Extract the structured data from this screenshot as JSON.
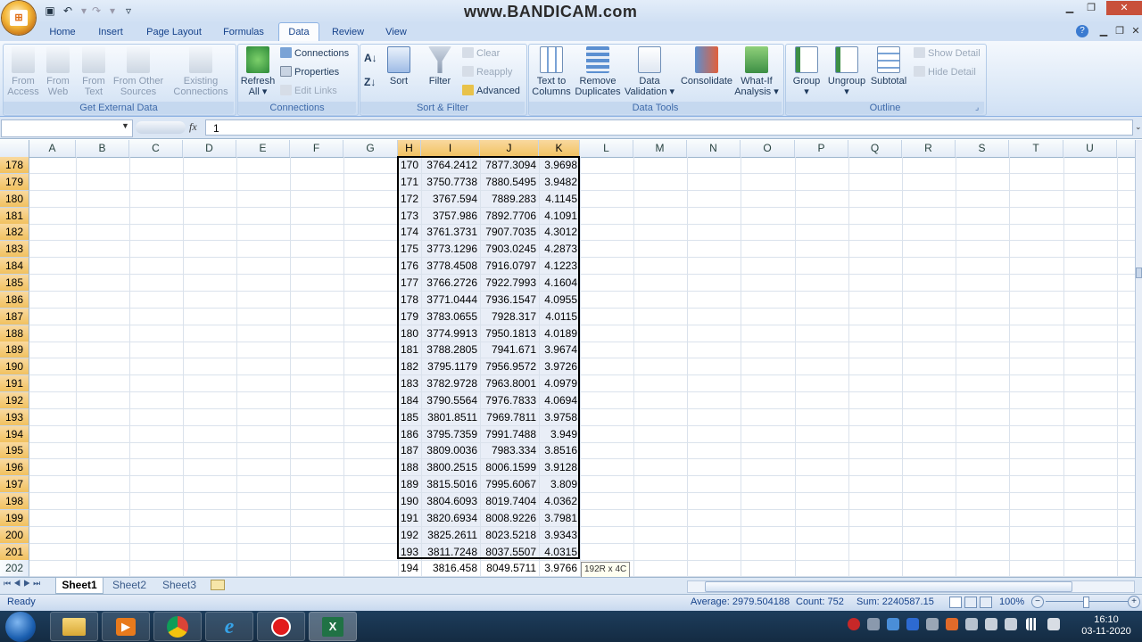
{
  "watermark": "www.BANDICAM.com",
  "tabs": [
    "Home",
    "Insert",
    "Page Layout",
    "Formulas",
    "Data",
    "Review",
    "View"
  ],
  "ribbon": {
    "get_external": {
      "label": "Get External Data",
      "buttons": [
        "From Access",
        "From Web",
        "From Text",
        "From Other Sources",
        "Existing Connections"
      ]
    },
    "connections": {
      "label": "Connections",
      "refresh": "Refresh All",
      "connections": "Connections",
      "properties": "Properties",
      "edit_links": "Edit Links"
    },
    "sort_filter": {
      "label": "Sort & Filter",
      "sort": "Sort",
      "filter": "Filter",
      "clear": "Clear",
      "reapply": "Reapply",
      "advanced": "Advanced"
    },
    "data_tools": {
      "label": "Data Tools",
      "text_to_columns": "Text to Columns",
      "remove_duplicates": "Remove Duplicates",
      "data_validation": "Data Validation",
      "consolidate": "Consolidate",
      "what_if": "What-If Analysis"
    },
    "outline": {
      "label": "Outline",
      "group": "Group",
      "ungroup": "Ungroup",
      "subtotal": "Subtotal",
      "show_detail": "Show Detail",
      "hide_detail": "Hide Detail"
    }
  },
  "formula_bar": {
    "fx": "fx",
    "value": "1",
    "name_box": ""
  },
  "columns": [
    "A",
    "B",
    "C",
    "D",
    "E",
    "F",
    "G",
    "H",
    "I",
    "J",
    "K",
    "L",
    "M",
    "N",
    "O",
    "P",
    "Q",
    "R",
    "S",
    "T",
    "U"
  ],
  "rows": [
    {
      "num": "178",
      "h": "170",
      "i": "3764.2412",
      "j": "7877.3094",
      "k": "3.9698"
    },
    {
      "num": "179",
      "h": "171",
      "i": "3750.7738",
      "j": "7880.5495",
      "k": "3.9482"
    },
    {
      "num": "180",
      "h": "172",
      "i": "3767.594",
      "j": "7889.283",
      "k": "4.1145"
    },
    {
      "num": "181",
      "h": "173",
      "i": "3757.986",
      "j": "7892.7706",
      "k": "4.1091"
    },
    {
      "num": "182",
      "h": "174",
      "i": "3761.3731",
      "j": "7907.7035",
      "k": "4.3012"
    },
    {
      "num": "183",
      "h": "175",
      "i": "3773.1296",
      "j": "7903.0245",
      "k": "4.2873"
    },
    {
      "num": "184",
      "h": "176",
      "i": "3778.4508",
      "j": "7916.0797",
      "k": "4.1223"
    },
    {
      "num": "185",
      "h": "177",
      "i": "3766.2726",
      "j": "7922.7993",
      "k": "4.1604"
    },
    {
      "num": "186",
      "h": "178",
      "i": "3771.0444",
      "j": "7936.1547",
      "k": "4.0955"
    },
    {
      "num": "187",
      "h": "179",
      "i": "3783.0655",
      "j": "7928.317",
      "k": "4.0115"
    },
    {
      "num": "188",
      "h": "180",
      "i": "3774.9913",
      "j": "7950.1813",
      "k": "4.0189"
    },
    {
      "num": "189",
      "h": "181",
      "i": "3788.2805",
      "j": "7941.671",
      "k": "3.9674"
    },
    {
      "num": "190",
      "h": "182",
      "i": "3795.1179",
      "j": "7956.9572",
      "k": "3.9726"
    },
    {
      "num": "191",
      "h": "183",
      "i": "3782.9728",
      "j": "7963.8001",
      "k": "4.0979"
    },
    {
      "num": "192",
      "h": "184",
      "i": "3790.5564",
      "j": "7976.7833",
      "k": "4.0694"
    },
    {
      "num": "193",
      "h": "185",
      "i": "3801.8511",
      "j": "7969.7811",
      "k": "3.9758"
    },
    {
      "num": "194",
      "h": "186",
      "i": "3795.7359",
      "j": "7991.7488",
      "k": "3.949"
    },
    {
      "num": "195",
      "h": "187",
      "i": "3809.0036",
      "j": "7983.334",
      "k": "3.8516"
    },
    {
      "num": "196",
      "h": "188",
      "i": "3800.2515",
      "j": "8006.1599",
      "k": "3.9128"
    },
    {
      "num": "197",
      "h": "189",
      "i": "3815.5016",
      "j": "7995.6067",
      "k": "3.809"
    },
    {
      "num": "198",
      "h": "190",
      "i": "3804.6093",
      "j": "8019.7404",
      "k": "4.0362"
    },
    {
      "num": "199",
      "h": "191",
      "i": "3820.6934",
      "j": "8008.9226",
      "k": "3.7981"
    },
    {
      "num": "200",
      "h": "192",
      "i": "3825.2611",
      "j": "8023.5218",
      "k": "3.9343"
    },
    {
      "num": "201",
      "h": "193",
      "i": "3811.7248",
      "j": "8037.5507",
      "k": "4.0315"
    },
    {
      "num": "202",
      "h": "194",
      "i": "3816.458",
      "j": "8049.5711",
      "k": "3.9766"
    }
  ],
  "selection_tip": "192R x 4C",
  "sheets": [
    "Sheet1",
    "Sheet2",
    "Sheet3"
  ],
  "status": {
    "ready": "Ready",
    "average": "Average: 2979.504188",
    "count": "Count: 752",
    "sum": "Sum: 2240587.15",
    "zoom": "100%"
  },
  "clock": {
    "time": "16:10",
    "date": "03-11-2020"
  },
  "colors": {
    "selection_header": "#f1c15f",
    "ribbon_bg": "#dbe8f7",
    "taskbar": "#1d3d5c"
  }
}
